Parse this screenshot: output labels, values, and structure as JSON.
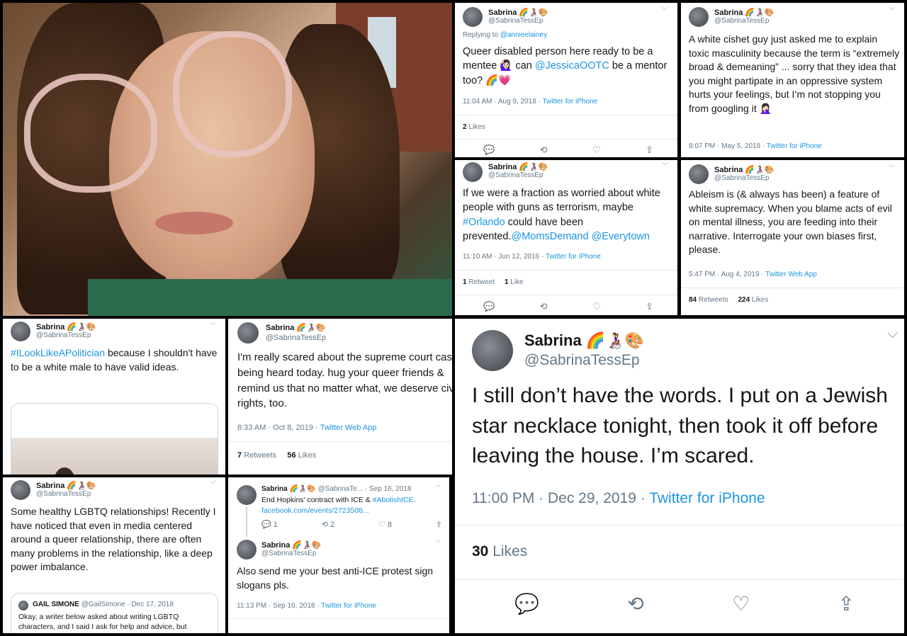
{
  "tweets": {
    "p2": {
      "name": "Sabrina",
      "emoji": "🌈👩‍🦽🎨",
      "handle": "@SabrinaTessEp",
      "reply": "Replying to",
      "reply_to": "@annieelainey",
      "t1": "Queer disabled person here ready to be a mentee 🙋🏻‍♀️ can ",
      "t2": "@JessicaOOTC",
      "t3": " be a mentor too? 🌈💗",
      "meta": "11:04 AM · Aug 9, 2018 · ",
      "source": "Twitter for iPhone",
      "likes_n": "2",
      "likes_l": "Likes"
    },
    "p3": {
      "name": "Sabrina",
      "emoji": "🌈👩‍🦽🎨",
      "handle": "@SabrinaTessEp",
      "text": "A white cishet guy just asked me to explain toxic masculinity because the term is “extremely broad & demeaning” ... sorry that they idea that you might partipate in an oppressive system hurts your feelings, but I’m not stopping you from googling it 🤦🏻‍♀️",
      "meta": "8:07 PM · May 5, 2018 · ",
      "source": "Twitter for iPhone"
    },
    "p4": {
      "name": "Sabrina",
      "emoji": "🌈👩‍🦽🎨",
      "handle": "@SabrinaTessEp",
      "t1": "If we were a fraction as worried about white people with guns as terrorism, maybe ",
      "t2": "#Orlando",
      "t3": " could have been prevented.",
      "t4": "@MomsDemand @Everytown",
      "meta": "11:10 AM · Jun 12, 2016 · ",
      "source": "Twitter for iPhone",
      "rt_n": "1",
      "rt_l": "Retweet",
      "likes_n": "1",
      "likes_l": "Like"
    },
    "p5": {
      "name": "Sabrina",
      "emoji": "🌈👩‍🦽🎨",
      "handle": "@SabrinaTessEp",
      "text": "Ableism is (& always has been) a feature of white supremacy. When you blame acts of evil on mental illness, you are feeding into their narrative. Interrogate your own biases first, please.",
      "meta": "5:47 PM · Aug 4, 2019 · ",
      "source": "Twitter Web App",
      "rt_n": "84",
      "rt_l": "Retweets",
      "likes_n": "224",
      "likes_l": "Likes"
    },
    "p6": {
      "name": "Sabrina",
      "emoji": "🌈👩‍🦽🎨",
      "handle": "@SabrinaTessEp",
      "t1": "#ILookLikeAPolitician",
      "t2": " because I shouldn't have to be a white male to have valid ideas."
    },
    "p7": {
      "name": "Sabrina",
      "emoji": "🌈👩‍🦽🎨",
      "handle": "@SabrinaTessEp",
      "text": "I'm really scared about the supreme court case being heard today. hug your queer friends & remind us that no matter what, we deserve civil rights, too.",
      "meta": "8:33 AM · Oct 8, 2019 · ",
      "source": "Twitter Web App",
      "rt_n": "7",
      "rt_l": "Retweets",
      "likes_n": "56",
      "likes_l": "Likes"
    },
    "p8": {
      "name": "Sabrina",
      "emoji": "🌈👩‍🦽🎨",
      "handle": "@SabrinaTessEp",
      "text": "Some healthy LGBTQ relationships! Recently I have noticed that even in media centered around a queer relationship, there are often many problems in the relationship, like a deep power imbalance.",
      "quote_name": "GAIL SIMONE",
      "quote_handle": "@GailSimone · Dec 17, 2018",
      "quote_text": "Okay, a writer below asked about writing LGBTQ characters, and I said I ask for help and advice, but"
    },
    "p9": {
      "name": "Sabrina",
      "emoji": "🌈👩‍🦽🎨",
      "handle_date": "@SabrinaTe... · Sep 16, 2018",
      "t1": "End Hopkins' contract with ICE & ",
      "t2": "#AbolishICE",
      ".": ".",
      "t3": "facebook.com/events/2723508...",
      "a1": "1",
      "a2": "2",
      "a3": "8",
      "name2": "Sabrina",
      "handle2": "@SabrinaTessEp",
      "text2": "Also send me your best anti-ICE protest sign slogans pls.",
      "meta": "11:13 PM · Sep 16, 2018 · ",
      "source": "Twitter for iPhone"
    },
    "p10": {
      "name": "Sabrina",
      "emoji": "🌈👩‍🦽🎨",
      "handle": "@SabrinaTessEp",
      "text": "I still don’t have the words. I put on a Jewish star necklace tonight, then took it off before leaving the house. I’m scared.",
      "meta": "11:00 PM · Dec 29, 2019 · ",
      "source": "Twitter for iPhone",
      "likes_n": "30",
      "likes_l": "Likes"
    }
  },
  "icons": {
    "reply": "💬",
    "retweet": "⟲",
    "like": "♡",
    "share": "⇪",
    "chevron": "⌵"
  }
}
